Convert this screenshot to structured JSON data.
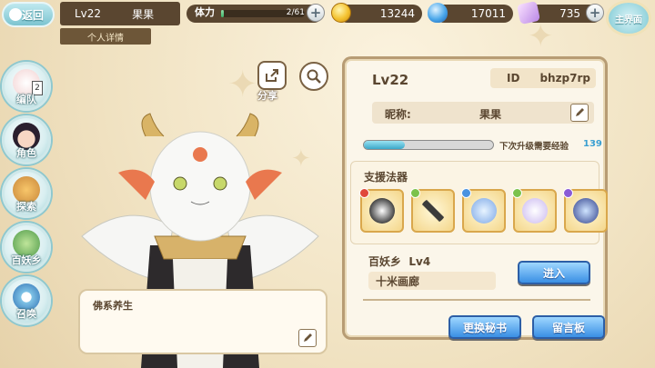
{
  "top": {
    "back_label": "返回",
    "level": "Lv22",
    "name": "果果",
    "detail_tab": "个人详情",
    "stamina_label": "体力",
    "stamina_value": "2/61",
    "stamina_fraction": 0.03,
    "coins": "13244",
    "gems": "17011",
    "tickets": "735",
    "main_label": "主界面"
  },
  "nav": [
    {
      "label": "编队",
      "badge": "2"
    },
    {
      "label": "角色"
    },
    {
      "label": "探索"
    },
    {
      "label": "百妖乡"
    },
    {
      "label": "召唤"
    }
  ],
  "actions": {
    "share_label": "分享"
  },
  "speech": {
    "text": "佛系养生"
  },
  "profile": {
    "level": "Lv22",
    "id_key": "ID",
    "id_value": "bhzp7rp",
    "nick_key": "昵称:",
    "nick_value": "果果",
    "xp_fraction": 0.32,
    "xp_text": "下次升级需要经验",
    "xp_value": "139",
    "support_title": "支援法器",
    "slots": [
      {
        "icon": "bell-helmet-icon",
        "color": "#e0473a"
      },
      {
        "icon": "bow-arrow-icon",
        "color": "#7bc24b"
      },
      {
        "icon": "potion-bottles-icon",
        "color": "#4a93e0"
      },
      {
        "icon": "crystal-orb-icon",
        "color": "#7bc24b"
      },
      {
        "icon": "sword-shield-icon",
        "color": "#8a5bd6"
      }
    ],
    "town": "百妖乡",
    "town_level": "Lv4",
    "place": "十米画廊",
    "enter_label": "进入",
    "change_secretary_label": "更换秘书",
    "message_board_label": "留言板"
  }
}
